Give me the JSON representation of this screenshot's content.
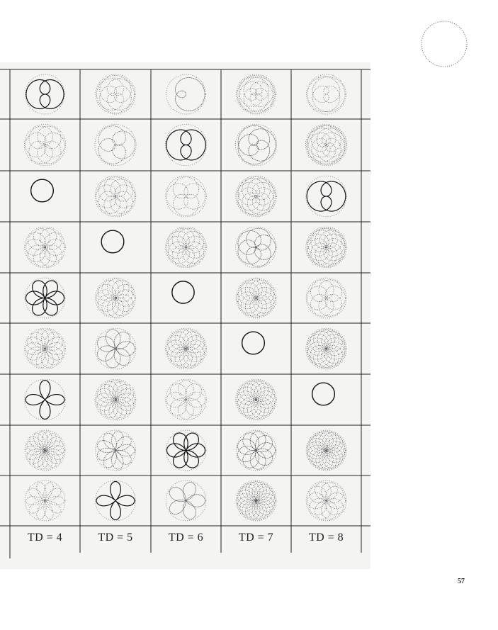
{
  "page": {
    "page_number": "57"
  },
  "table": {
    "column_labels": [
      "TD = 4",
      "TD = 5",
      "TD = 6",
      "TD = 7",
      "TD = 8"
    ],
    "columns": [
      4,
      5,
      6,
      7,
      8
    ],
    "rows": 9
  }
}
